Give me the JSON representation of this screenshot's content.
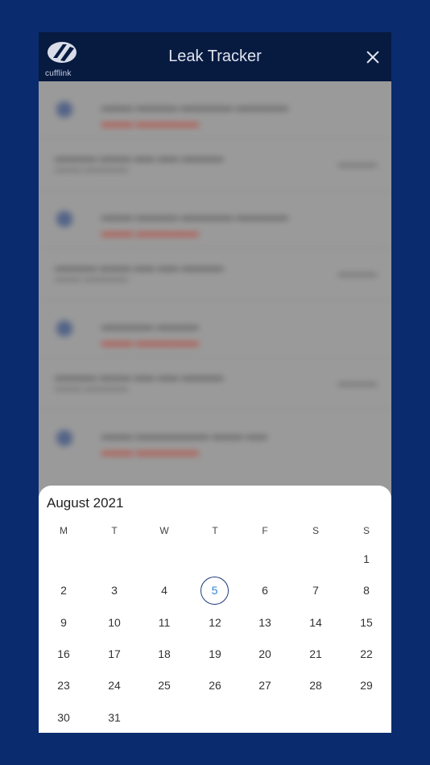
{
  "header": {
    "logo_text": "cufflink",
    "title": "Leak Tracker"
  },
  "calendar": {
    "month_label": "August 2021",
    "weekdays": [
      "M",
      "T",
      "W",
      "T",
      "F",
      "S",
      "S"
    ],
    "selected_day": 5,
    "weeks": [
      [
        "",
        "",
        "",
        "",
        "",
        "",
        "1"
      ],
      [
        "2",
        "3",
        "4",
        "5",
        "6",
        "7",
        "8"
      ],
      [
        "9",
        "10",
        "11",
        "12",
        "13",
        "14",
        "15"
      ],
      [
        "16",
        "17",
        "18",
        "19",
        "20",
        "21",
        "22"
      ],
      [
        "23",
        "24",
        "25",
        "26",
        "27",
        "28",
        "29"
      ],
      [
        "30",
        "31",
        "",
        "",
        "",
        "",
        ""
      ]
    ]
  },
  "colors": {
    "background": "#0a2c6e",
    "header": "#071a40",
    "today_ring": "#1d3a78",
    "today_text": "#2e86d8"
  },
  "icons": {
    "logo": "cufflink-logo",
    "close": "close-icon"
  }
}
